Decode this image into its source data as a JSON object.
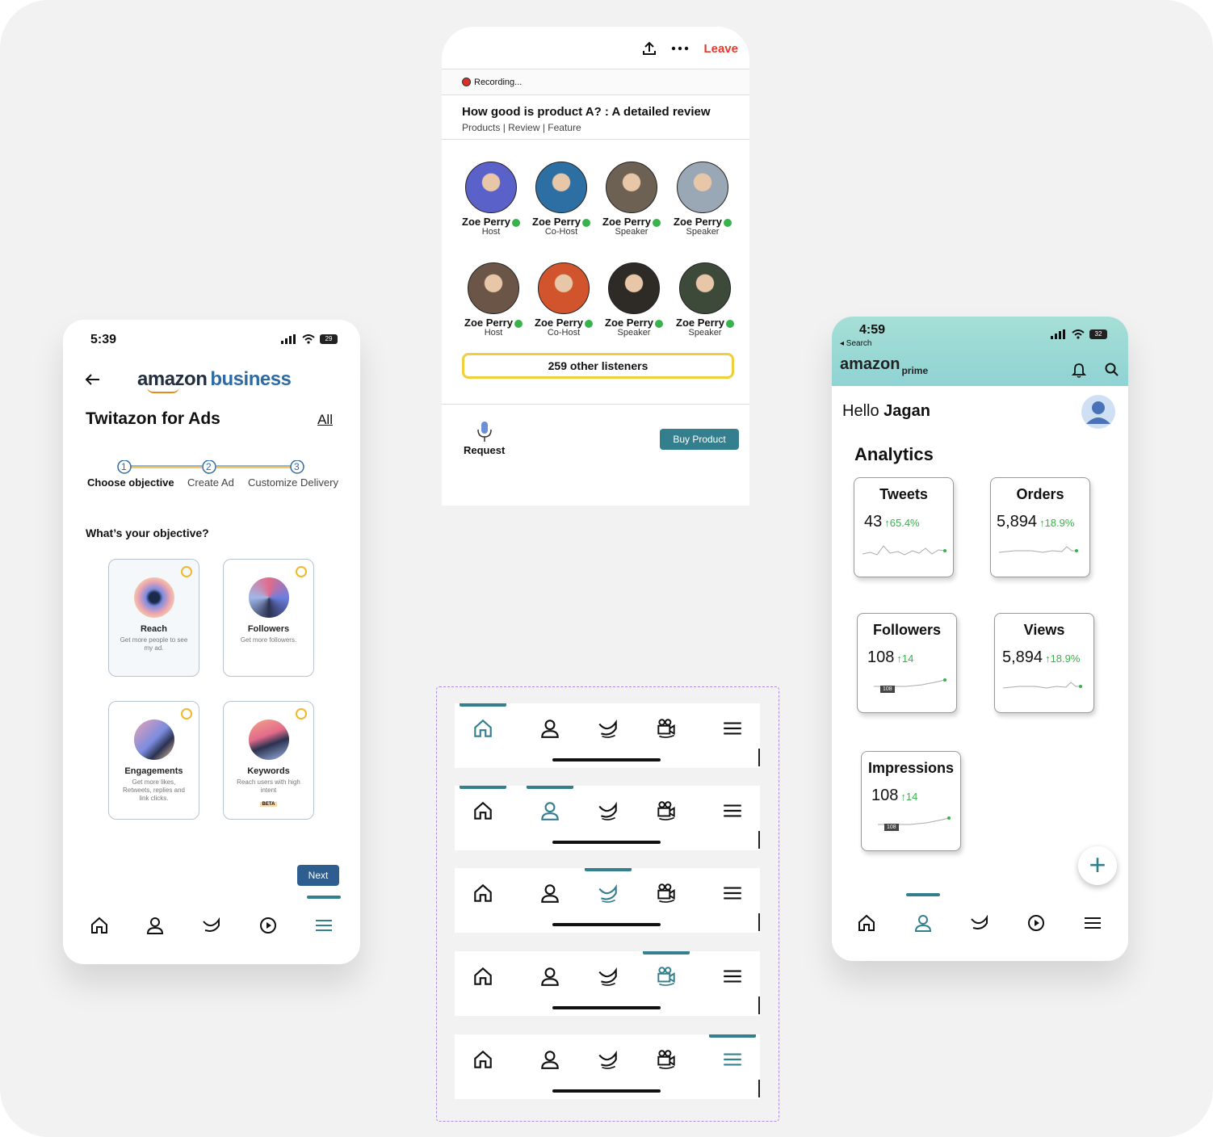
{
  "ads_screen": {
    "time": "5:39",
    "battery": "29",
    "brand_a": "amazon",
    "brand_b": "business",
    "title": "Twitazon for Ads",
    "all_link": "All",
    "steps": [
      {
        "num": "1",
        "label": "Choose objective"
      },
      {
        "num": "2",
        "label": "Create Ad"
      },
      {
        "num": "3",
        "label": "Customize Delivery"
      }
    ],
    "question": "What’s your objective?",
    "objectives": [
      {
        "title": "Reach",
        "desc": "Get more people to see my ad."
      },
      {
        "title": "Followers",
        "desc": "Get more followers."
      },
      {
        "title": "Engagements",
        "desc": "Get more likes, Retweets, replies and link clicks."
      },
      {
        "title": "Keywords",
        "desc": "Reach users with high intent",
        "badge": "BETA"
      }
    ],
    "next_label": "Next"
  },
  "space_screen": {
    "leave_label": "Leave",
    "recording": "Recording...",
    "title": "How good is product A? : A detailed review",
    "tags": "Products | Review | Feature",
    "people": [
      {
        "name": "Zoe Perry",
        "role": "Host"
      },
      {
        "name": "Zoe Perry",
        "role": "Co-Host"
      },
      {
        "name": "Zoe Perry",
        "role": "Speaker"
      },
      {
        "name": "Zoe Perry",
        "role": "Speaker"
      },
      {
        "name": "Zoe Perry",
        "role": "Host"
      },
      {
        "name": "Zoe Perry",
        "role": "Co-Host"
      },
      {
        "name": "Zoe Perry",
        "role": "Speaker"
      },
      {
        "name": "Zoe Perry",
        "role": "Speaker"
      }
    ],
    "listeners": "259 other listeners",
    "request_label": "Request",
    "buy_label": "Buy Product"
  },
  "nav_variants": {
    "icons": [
      "home-icon",
      "profile-icon",
      "bird-icon",
      "video-icon",
      "menu-icon"
    ],
    "active_index": [
      0,
      1,
      2,
      3,
      4
    ]
  },
  "analytics_screen": {
    "time": "4:59",
    "back_label": "◂ Search",
    "battery": "32",
    "brand": "amazon",
    "brand_sub": "prime",
    "greeting_prefix": "Hello ",
    "greeting_name": "Jagan",
    "heading": "Analytics",
    "cards": [
      {
        "title": "Tweets",
        "value": "43",
        "change": "↑65.4%"
      },
      {
        "title": "Orders",
        "value": "5,894",
        "change": "↑18.9%"
      },
      {
        "title": "Followers",
        "value": "108",
        "change": "↑14",
        "tag": "108"
      },
      {
        "title": "Views",
        "value": "5,894",
        "change": "↑18.9%"
      },
      {
        "title": "Impressions",
        "value": "108",
        "change": "↑14",
        "tag": "108"
      }
    ],
    "fab": "+"
  },
  "colors": {
    "accent": "#347f8d",
    "leave": "#e23b2e",
    "positive": "#38b24a",
    "highlight": "#f1cf3a"
  }
}
